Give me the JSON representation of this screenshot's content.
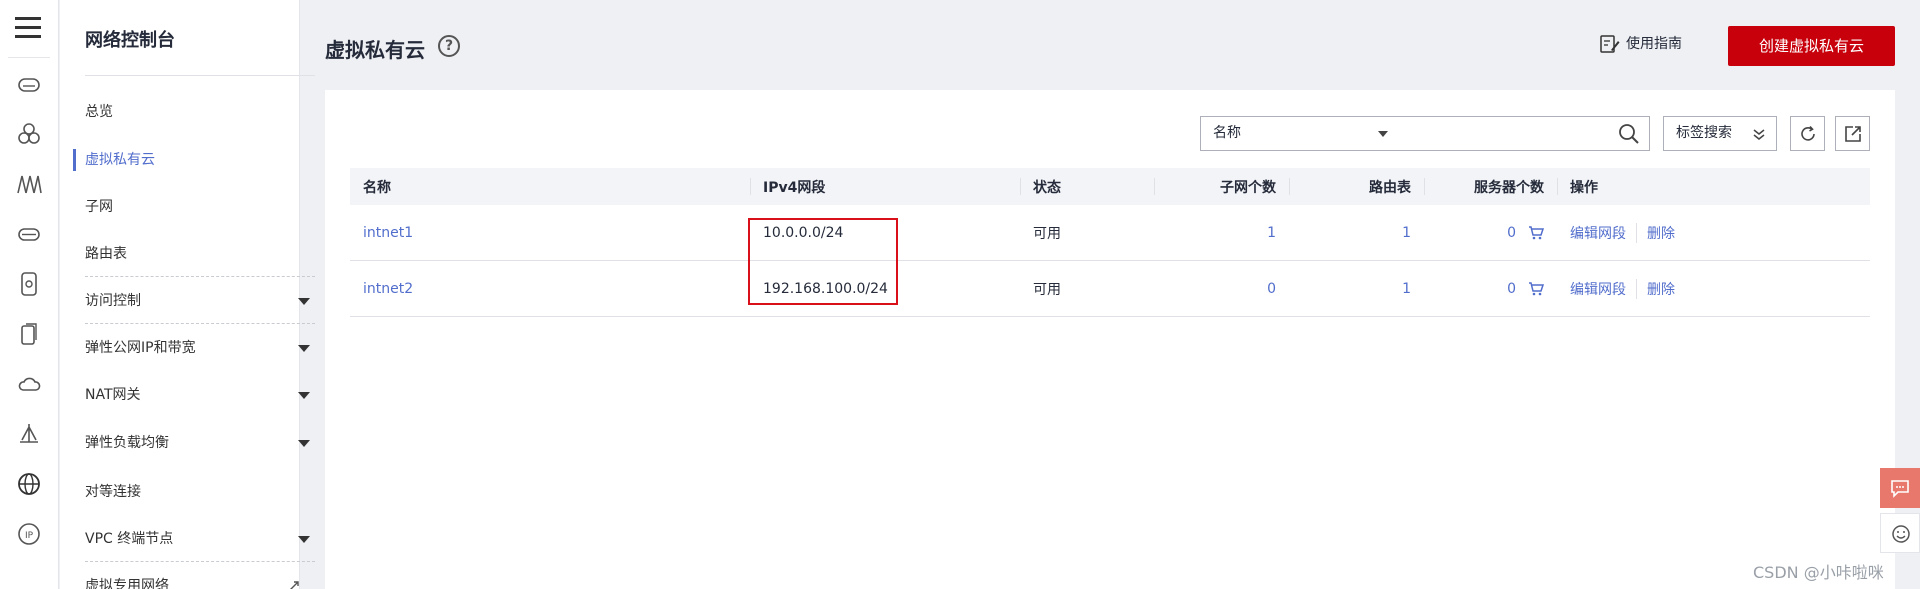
{
  "sidebar": {
    "title": "网络控制台",
    "items": [
      {
        "label": "总览"
      },
      {
        "label": "虚拟私有云"
      },
      {
        "label": "子网"
      },
      {
        "label": "路由表"
      },
      {
        "label": "访问控制"
      },
      {
        "label": "弹性公网IP和带宽"
      },
      {
        "label": "NAT网关"
      },
      {
        "label": "弹性负载均衡"
      },
      {
        "label": "对等连接"
      },
      {
        "label": "VPC 终端节点"
      },
      {
        "label": "虚拟专用网络"
      }
    ]
  },
  "rail_icons": [
    "vpc-icon",
    "eip-icon",
    "elb-icon",
    "nat-icon",
    "vpn-icon",
    "connection-icon",
    "cloud-icon",
    "endpoint-icon",
    "global-icon",
    "ip-icon"
  ],
  "header": {
    "title": "虚拟私有云",
    "help": "?",
    "guide_label": "使用指南",
    "create_label": "创建虚拟私有云"
  },
  "filter": {
    "field_label": "名称",
    "search_placeholder": "",
    "tag_search_label": "标签搜索"
  },
  "table": {
    "columns": [
      "名称",
      "IPv4网段",
      "状态",
      "子网个数",
      "路由表",
      "服务器个数",
      "操作"
    ],
    "rows": [
      {
        "name": "intnet1",
        "cidr": "10.0.0.0/24",
        "status": "可用",
        "subnets": "1",
        "route_tables": "1",
        "servers": "0",
        "op_edit": "编辑网段",
        "op_delete": "删除"
      },
      {
        "name": "intnet2",
        "cidr": "192.168.100.0/24",
        "status": "可用",
        "subnets": "0",
        "route_tables": "1",
        "servers": "0",
        "op_edit": "编辑网段",
        "op_delete": "删除"
      }
    ]
  },
  "colors": {
    "primary": "#c7000b",
    "link": "#526ecc",
    "highlight": "#d9101a"
  },
  "watermark": "CSDN @小咔啦咪"
}
